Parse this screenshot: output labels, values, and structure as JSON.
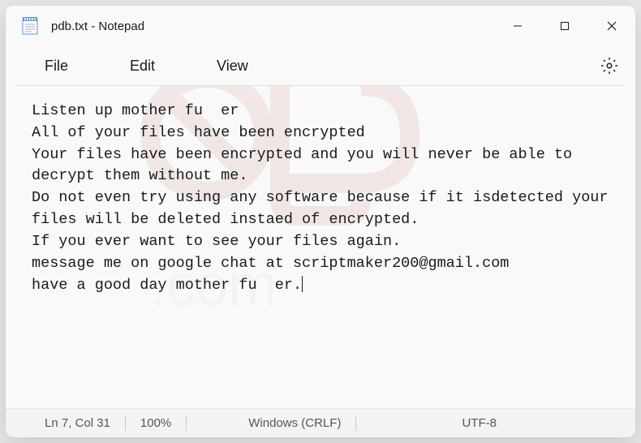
{
  "window": {
    "title": "pdb.txt - Notepad"
  },
  "menu": {
    "file": "File",
    "edit": "Edit",
    "view": "View"
  },
  "editor": {
    "content": "Listen up mother fu  er\nAll of your files have been encrypted\nYour files have been encrypted and you will never be able to decrypt them without me.\nDo not even try using any software because if it isdetected your files will be deleted instaed of encrypted.\nIf you ever want to see your files again.\nmessage me on google chat at scriptmaker200@gmail.com\nhave a good day mother fu  er."
  },
  "status": {
    "position": "Ln 7, Col 31",
    "zoom": "100%",
    "line_ending": "Windows (CRLF)",
    "encoding": "UTF-8"
  }
}
